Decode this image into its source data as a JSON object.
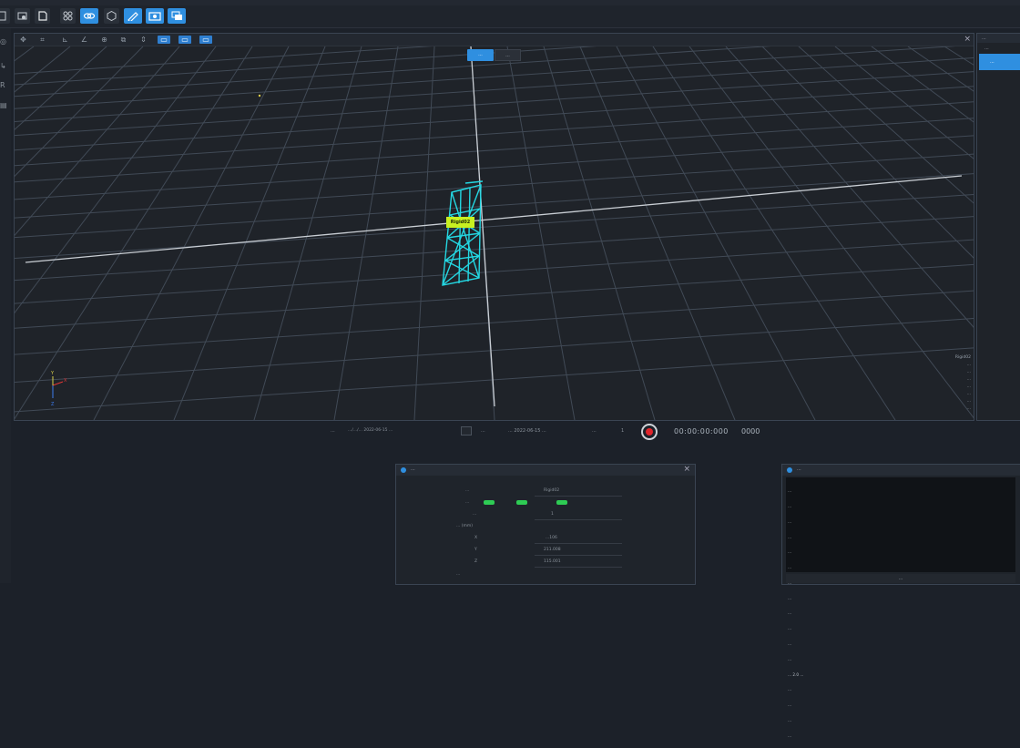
{
  "toolbar": {
    "buttons": [
      {
        "icon": "new-file-icon",
        "active": false
      },
      {
        "icon": "open-folder-icon",
        "active": false
      },
      {
        "icon": "save-icon",
        "active": false
      },
      {
        "icon": "grid-view-icon",
        "active": false
      },
      {
        "icon": "link-icon",
        "active": true
      },
      {
        "icon": "hexagon-icon",
        "active": false
      },
      {
        "icon": "edit-icon",
        "active": true
      },
      {
        "icon": "camera-icon",
        "active": true
      },
      {
        "icon": "layers-icon",
        "active": true
      }
    ]
  },
  "left_strip": {
    "icons": [
      "target-icon",
      "pointer-icon",
      "ruler-icon",
      "image-icon"
    ]
  },
  "viewport": {
    "tools": [
      "move-icon",
      "select-icon",
      "measure-icon",
      "rotate-icon",
      "copy-icon",
      "pan-icon",
      "zoom-icon"
    ],
    "view_toggle_a": "...",
    "view_toggle_b": "...",
    "tower_label": "Rigid02",
    "stats": [
      "Rigid02",
      "...",
      "...",
      "...",
      "...",
      "...",
      "...",
      "..."
    ],
    "axis_labels": {
      "x": "X",
      "y": "Y",
      "z": "Z"
    }
  },
  "right_panel": {
    "header": "...",
    "row1": "...",
    "row2": "..."
  },
  "status": {
    "path_label": "...",
    "path_value": ".../.../... 2022-06-15 ...",
    "time_label": "...",
    "time_value": "... 2022-06-15 ...",
    "rate_label": "...",
    "rate_value": "1",
    "timer": "00:00:00:000",
    "frames": "0000"
  },
  "dialog": {
    "title": "...",
    "rows": [
      {
        "label": "...",
        "value": "Rigid02"
      },
      {
        "label": "...",
        "value": ""
      },
      {
        "label": "...",
        "value": "1"
      },
      {
        "label": "... (mm)",
        "value": ""
      },
      {
        "label": "X",
        "value": "...106"
      },
      {
        "label": "Y",
        "value": "211.008"
      },
      {
        "label": "Z",
        "value": "115.001"
      },
      {
        "label": "...",
        "value": ""
      }
    ]
  },
  "log": {
    "title": "...",
    "lines": [
      "...",
      "...",
      "...",
      "...",
      "...",
      "...",
      "...",
      "...",
      "...",
      "...",
      "...",
      "...",
      "... 2.0 ...",
      "...",
      "...",
      "...",
      "..."
    ],
    "footer": "..."
  }
}
